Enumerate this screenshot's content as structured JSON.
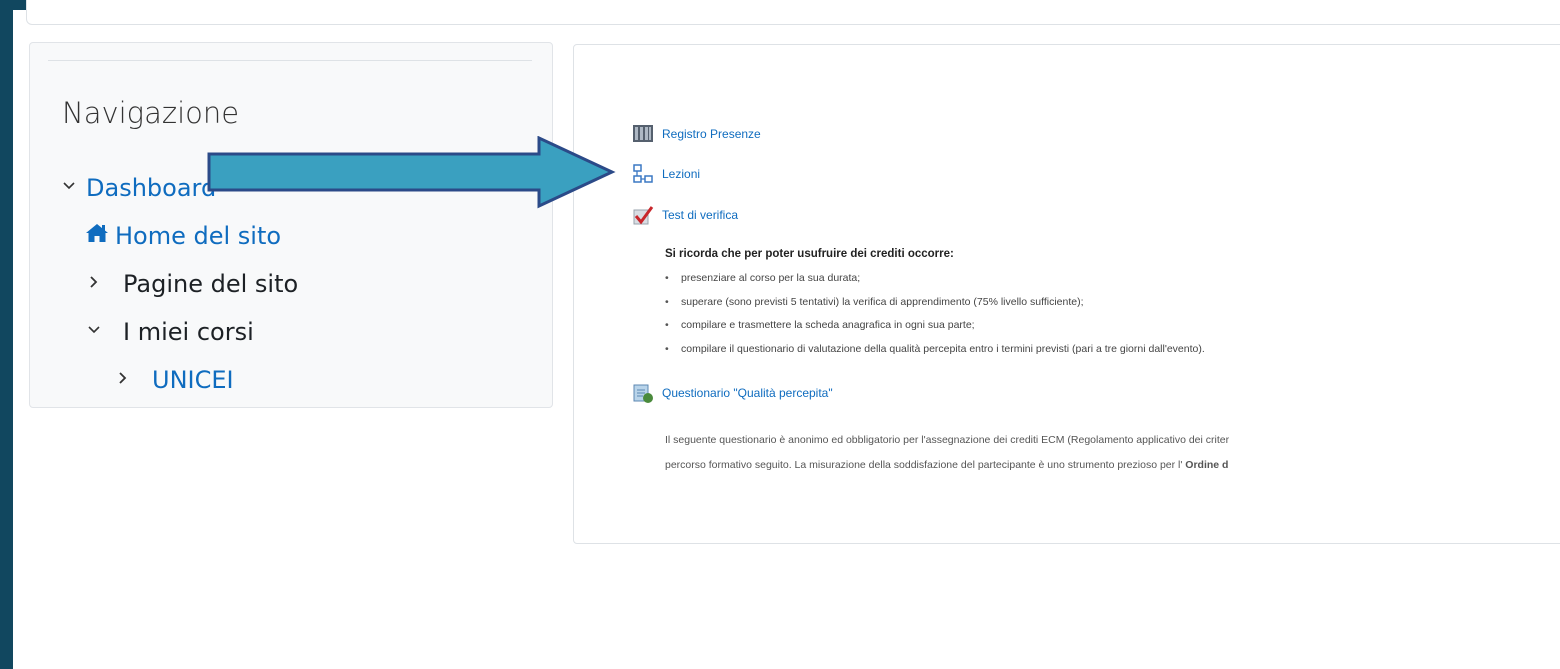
{
  "navigation": {
    "title": "Navigazione",
    "items": [
      {
        "label": "Dashboard",
        "chevron": "⌄"
      },
      {
        "label": "Home del sito",
        "icon": "home-icon"
      },
      {
        "label": "Pagine del sito",
        "chevron": "›"
      },
      {
        "label": "I miei corsi",
        "chevron": "⌄"
      },
      {
        "label": "UNICEI",
        "chevron": "›"
      }
    ]
  },
  "activities": [
    {
      "label": "Registro Presenze",
      "icon": "register-icon"
    },
    {
      "label": "Lezioni",
      "icon": "lessons-icon"
    },
    {
      "label": "Test di verifica",
      "icon": "quiz-check-icon"
    },
    {
      "label": "Questionario \"Qualità percepita\"",
      "icon": "feedback-icon"
    }
  ],
  "note": {
    "title": "Si ricorda che per poter usufruire dei crediti occorre:",
    "bullets": [
      "presenziare al corso per la sua durata;",
      "superare (sono previsti 5 tentativi) la verifica di apprendimento (75% livello sufficiente);",
      "compilare e trasmettere la scheda anagrafica in ogni sua parte;",
      "compilare il questionario di valutazione della qualità percepita entro i termini previsti (pari a tre giorni dall'evento)."
    ]
  },
  "paragraph": {
    "line1": "Il seguente questionario è anonimo ed obbligatorio per l'assegnazione dei crediti ECM (Regolamento applicativo dei criter",
    "line2_start": "percorso formativo seguito. La misurazione della soddisfazione del partecipante è uno strumento prezioso per l' ",
    "line2_bold": "Ordine d"
  },
  "colors": {
    "link": "#0f6cbf",
    "frame": "#11475f",
    "arrow_fill": "#3aa0c0",
    "arrow_stroke": "#2b4a88"
  }
}
